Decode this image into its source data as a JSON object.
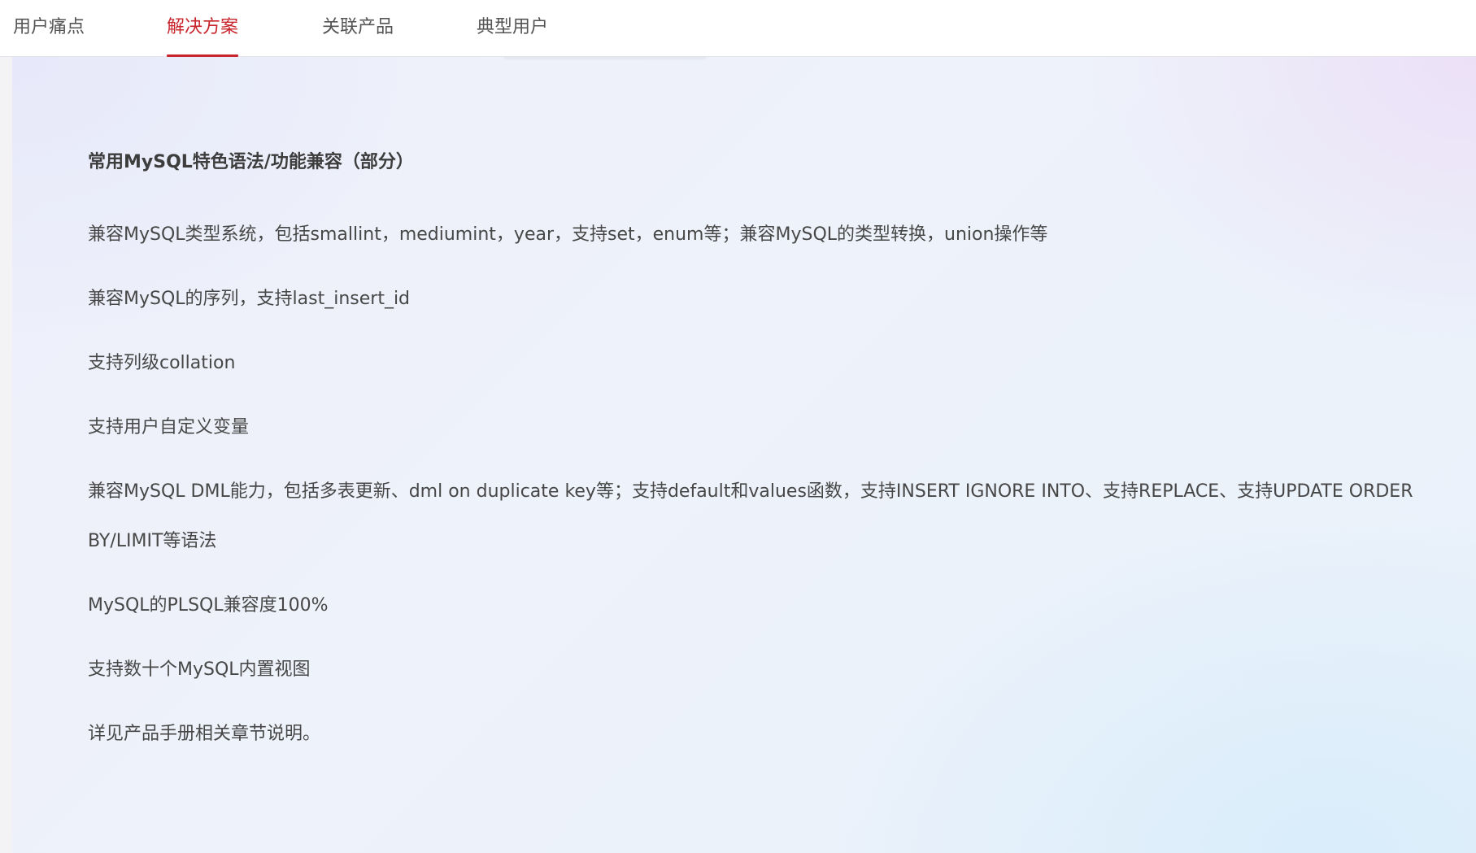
{
  "tabs": [
    {
      "label": "用户痛点",
      "active": false
    },
    {
      "label": "解决方案",
      "active": true
    },
    {
      "label": "关联产品",
      "active": false
    },
    {
      "label": "典型用户",
      "active": false
    }
  ],
  "main": {
    "heading": "常用MySQL特色语法/功能兼容（部分）",
    "items": [
      "兼容MySQL类型系统，包括smallint，mediumint，year，支持set，enum等；兼容MySQL的类型转换，union操作等",
      "兼容MySQL的序列，支持last_insert_id",
      "支持列级collation",
      "支持用户自定义变量",
      "兼容MySQL DML能力，包括多表更新、dml on duplicate key等；支持default和values函数，支持INSERT IGNORE INTO、支持REPLACE、支持UPDATE ORDER BY/LIMIT等语法",
      "MySQL的PLSQL兼容度100%",
      "支持数十个MySQL内置视图",
      "详见产品手册相关章节说明。"
    ]
  },
  "colors": {
    "accent": "#c8252c",
    "text": "#474747",
    "tab_text": "#555555"
  }
}
